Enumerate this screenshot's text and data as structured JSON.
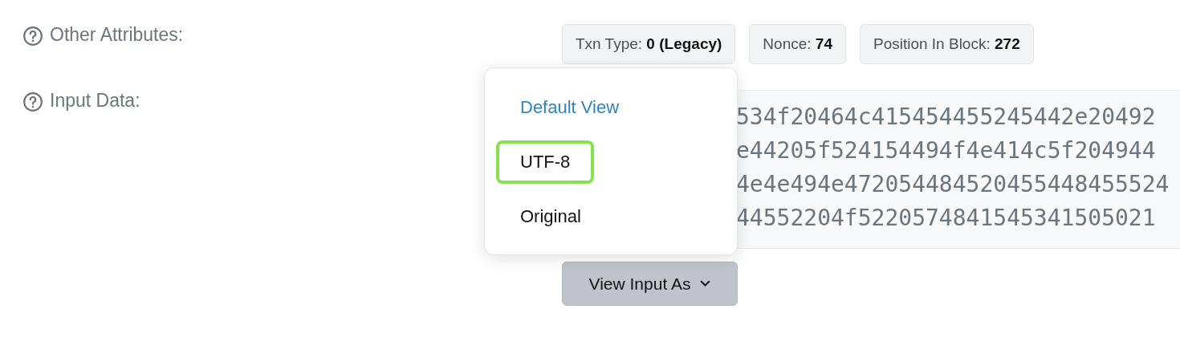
{
  "rows": [
    {
      "label": "Other Attributes:"
    },
    {
      "label": "Input Data:"
    }
  ],
  "attributes": [
    {
      "name": "Txn Type:",
      "value": "0 (Legacy)"
    },
    {
      "name": "Nonce:",
      "value": "74"
    },
    {
      "name": "Position In Block:",
      "value": "272"
    }
  ],
  "input_data": {
    "lines": [
      "534f20464c415454455245442e20492",
      "e44205f524154494f4e414c5f204944",
      "4e4e494e472054484520455448455524",
      "44552204f5220574841545341505021"
    ]
  },
  "menu": {
    "items": [
      {
        "label": "Default View",
        "selected": true,
        "outlined": false
      },
      {
        "label": "UTF-8",
        "selected": false,
        "outlined": true
      },
      {
        "label": "Original",
        "selected": false,
        "outlined": false
      }
    ]
  },
  "view_button": {
    "label": "View Input As"
  }
}
